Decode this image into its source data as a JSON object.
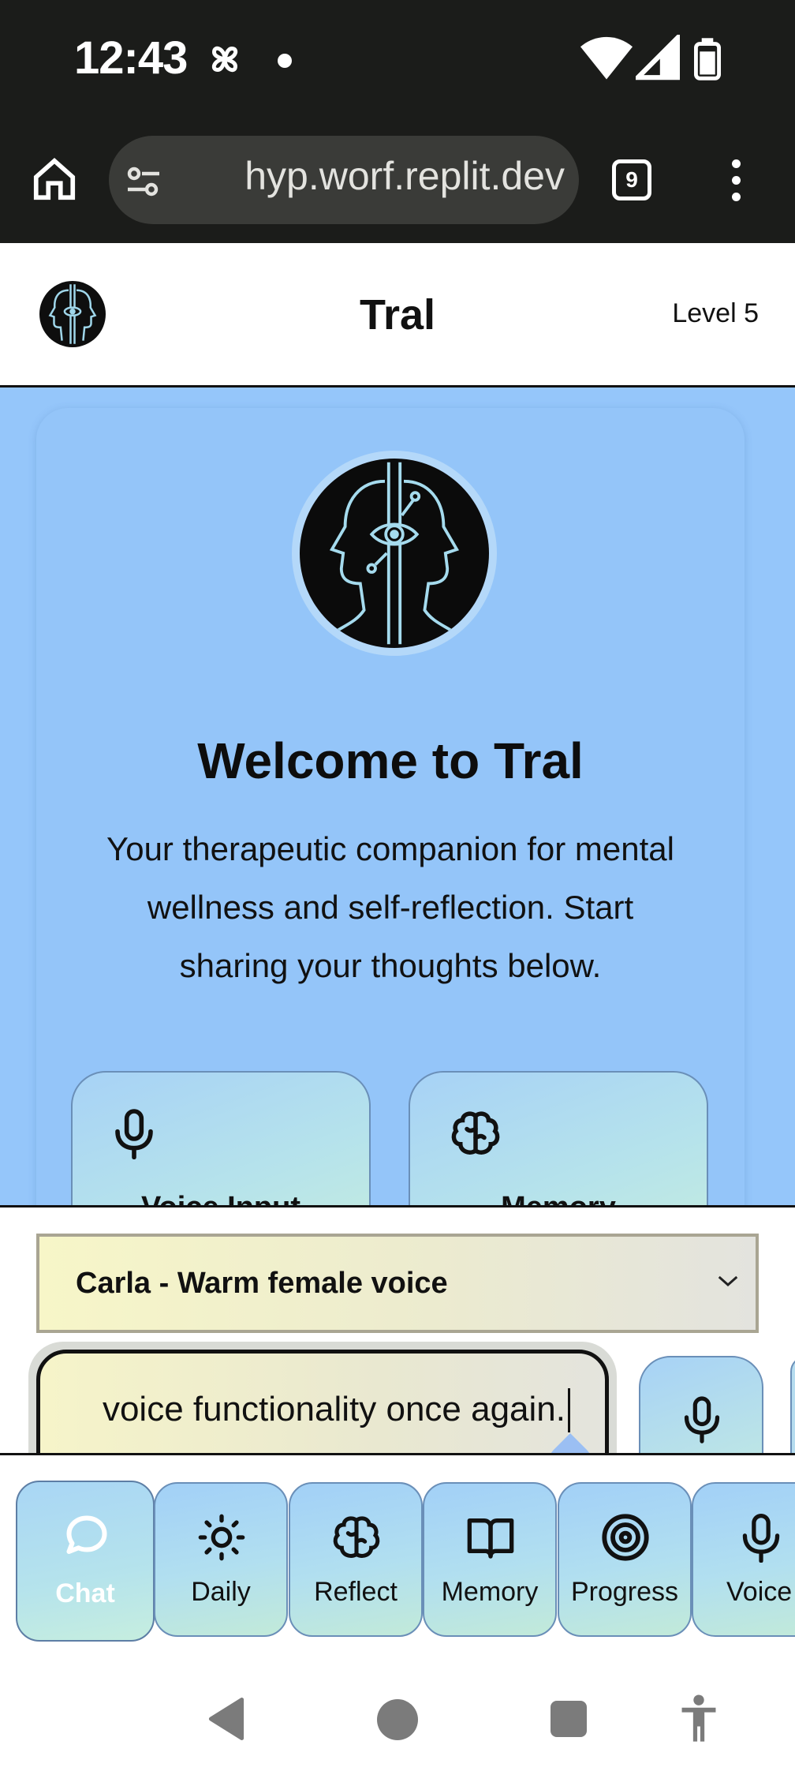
{
  "status_bar": {
    "time": "12:43"
  },
  "browser": {
    "url": "hyp.worf.replit.dev",
    "tab_count": "9"
  },
  "app_header": {
    "title": "Tral",
    "level": "Level 5"
  },
  "welcome": {
    "heading": "Welcome to Tral",
    "intro": "Your therapeutic companion for mental wellness and self-reflection. Start sharing your thoughts below."
  },
  "features": [
    {
      "label": "Voice Input",
      "icon": "microphone-icon"
    },
    {
      "label": "Memory",
      "icon": "brain-icon"
    }
  ],
  "voice_select": {
    "selected": "Carla - Warm female voice"
  },
  "message_input": {
    "value": "voice functionality once again."
  },
  "bottom_nav": [
    {
      "label": "Chat",
      "icon": "chat-bubble-icon",
      "active": true
    },
    {
      "label": "Daily",
      "icon": "sun-icon"
    },
    {
      "label": "Reflect",
      "icon": "brain-icon"
    },
    {
      "label": "Memory",
      "icon": "book-icon"
    },
    {
      "label": "Progress",
      "icon": "target-icon"
    },
    {
      "label": "Voice",
      "icon": "microphone-icon"
    }
  ],
  "colors": {
    "accent_bg": "#95c6fa",
    "button_gradient_start": "#a2d0f7",
    "button_gradient_end": "#c2ead9"
  }
}
